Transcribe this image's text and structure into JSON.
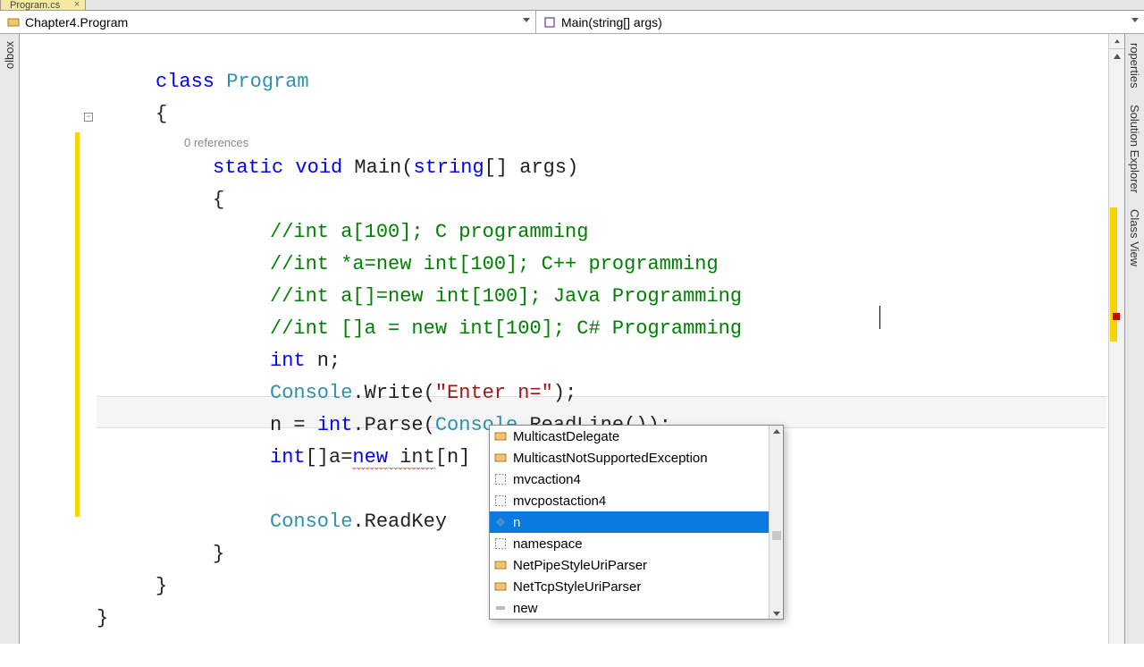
{
  "tab": {
    "title": "Program.cs"
  },
  "nav": {
    "left_label": "Chapter4.Program",
    "right_label": "Main(string[] args)"
  },
  "side": {
    "left": "olbox",
    "right_top": "Solution Explorer",
    "right_bottom": "Class View",
    "props": "roperties"
  },
  "code": {
    "references": "0 references",
    "l0_a": "class",
    "l0_b": "Program",
    "l1": "{",
    "l2_a": "static",
    "l2_b": "void",
    "l2_c": " Main(",
    "l2_d": "string",
    "l2_e": "[] args)",
    "l3": "{",
    "c1": "//int a[100]; C programming",
    "c2": "//int *a=new int[100]; C++ programming",
    "c3": "//int a[]=new int[100]; Java Programming",
    "c4": "//int []a = new int[100]; C# Programming",
    "l8_a": "int",
    "l8_b": " n;",
    "l9_a": "Console",
    "l9_b": ".Write(",
    "l9_c": "\"Enter n=\"",
    "l9_d": ");",
    "l10_a": "n = ",
    "l10_b": "int",
    "l10_c": ".Parse(",
    "l10_d": "Console",
    "l10_e": ".ReadLine());",
    "l11_a": "int",
    "l11_b": "[]a=",
    "l11_c": "new",
    "l11_d": " int",
    "l11_e": "[n]",
    "l12_a": "Console",
    "l12_b": ".ReadKey",
    "l13": "}",
    "l14": "}",
    "l15": "}"
  },
  "intellisense": {
    "items": [
      {
        "label": "MulticastDelegate",
        "kind": "class"
      },
      {
        "label": "MulticastNotSupportedException",
        "kind": "class"
      },
      {
        "label": "mvcaction4",
        "kind": "snippet"
      },
      {
        "label": "mvcpostaction4",
        "kind": "snippet"
      },
      {
        "label": "n",
        "kind": "field"
      },
      {
        "label": "namespace",
        "kind": "snippet"
      },
      {
        "label": "NetPipeStyleUriParser",
        "kind": "class"
      },
      {
        "label": "NetTcpStyleUriParser",
        "kind": "class"
      },
      {
        "label": "new",
        "kind": "keyword"
      }
    ],
    "selected_index": 4
  }
}
